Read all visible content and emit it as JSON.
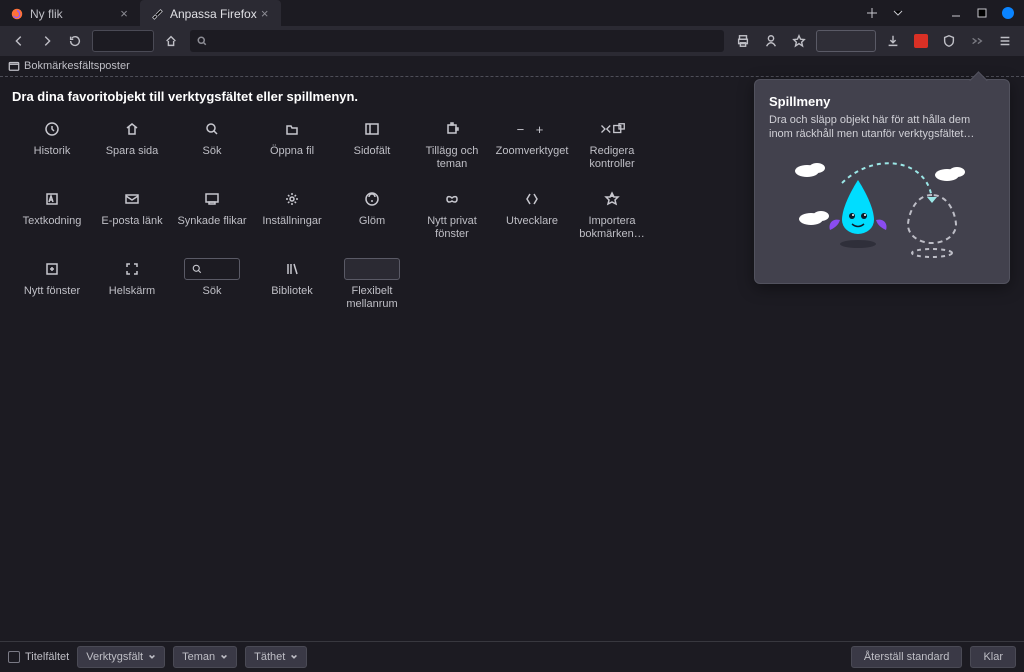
{
  "tabs": [
    {
      "label": "Ny flik",
      "icon": "firefox"
    },
    {
      "label": "Anpassa Firefox",
      "icon": "brush"
    }
  ],
  "bookmarks_row": {
    "label": "Bokmärkesfältsposter"
  },
  "customize": {
    "heading": "Dra dina favoritobjekt till verktygsfältet eller spillmenyn.",
    "items": [
      {
        "icon": "history",
        "label": "Historik"
      },
      {
        "icon": "save",
        "label": "Spara sida"
      },
      {
        "icon": "search",
        "label": "Sök"
      },
      {
        "icon": "openfile",
        "label": "Öppna fil"
      },
      {
        "icon": "sidebar",
        "label": "Sidofält"
      },
      {
        "icon": "addons",
        "label": "Tillägg och teman"
      },
      {
        "icon": "zoom",
        "label": "Zoomverktyget"
      },
      {
        "icon": "editctrl",
        "label": "Redigera kontroller"
      },
      {
        "icon": "encoding",
        "label": "Textkodning"
      },
      {
        "icon": "emaillink",
        "label": "E-posta länk"
      },
      {
        "icon": "syncedtabs",
        "label": "Synkade flikar"
      },
      {
        "icon": "settings",
        "label": "Inställningar"
      },
      {
        "icon": "forget",
        "label": "Glöm"
      },
      {
        "icon": "private",
        "label": "Nytt privat fönster"
      },
      {
        "icon": "devtools",
        "label": "Utvecklare"
      },
      {
        "icon": "importbm",
        "label": "Importera bokmärken…"
      },
      {
        "icon": "newwin",
        "label": "Nytt fönster"
      },
      {
        "icon": "fullscreen",
        "label": "Helskärm"
      },
      {
        "icon": "searchbox",
        "label": "Sök"
      },
      {
        "icon": "library",
        "label": "Bibliotek"
      },
      {
        "icon": "flexspace",
        "label": "Flexibelt mellanrum"
      }
    ]
  },
  "overflow": {
    "title": "Spillmeny",
    "desc": "Dra och släpp objekt här för att hålla dem inom räckhåll men utanför verktygsfältet…"
  },
  "bottombar": {
    "titlebar_check": "Titelfältet",
    "toolbars_drop": "Verktygsfält",
    "themes_drop": "Teman",
    "density_drop": "Täthet",
    "reset": "Återställ standard",
    "done": "Klar"
  },
  "colors": {
    "firefox_orange": "#ff7139",
    "firefox_purple": "#9059ff",
    "accent_blue": "#0a84ff",
    "drop_cyan": "#00ddff",
    "drop_body": "#6f3bd1"
  }
}
